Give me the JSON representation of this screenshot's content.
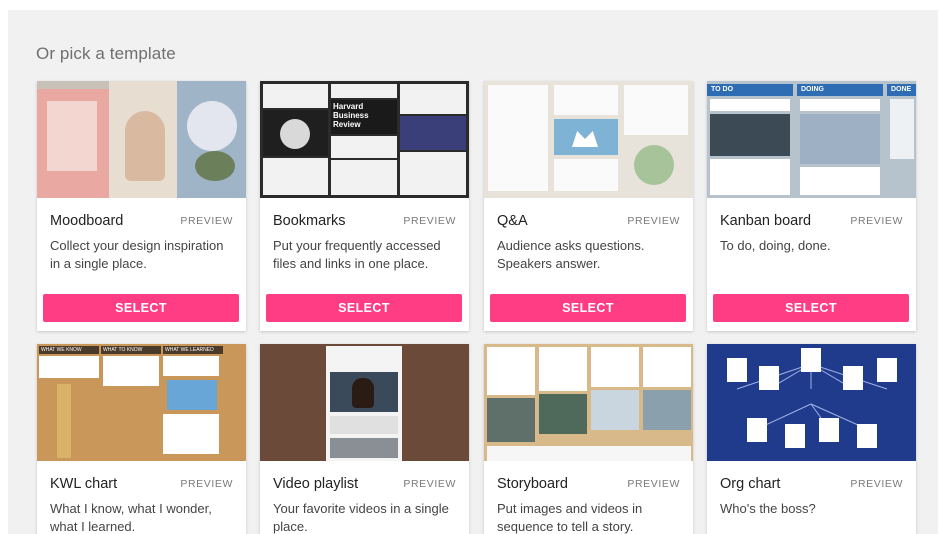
{
  "heading": "Or pick a template",
  "preview_label": "PREVIEW",
  "select_label": "SELECT",
  "cards": [
    {
      "title": "Moodboard",
      "description": "Collect your design inspiration in a single place."
    },
    {
      "title": "Bookmarks",
      "description": "Put your frequently accessed files and links in one place."
    },
    {
      "title": "Q&A",
      "description": "Audience asks questions. Speakers answer."
    },
    {
      "title": "Kanban board",
      "description": "To do, doing, done."
    },
    {
      "title": "KWL chart",
      "description": "What I know, what I wonder, what I learned."
    },
    {
      "title": "Video playlist",
      "description": "Your favorite videos in a single place."
    },
    {
      "title": "Storyboard",
      "description": "Put images and videos in sequence to tell a story."
    },
    {
      "title": "Org chart",
      "description": "Who's the boss?"
    }
  ],
  "thumbnails": {
    "bookmarks_headline": "Harvard Business Review",
    "kanban_columns": [
      "TO DO",
      "DOING",
      "DONE"
    ],
    "kwl_columns": [
      "WHAT WE KNOW",
      "WHAT TO KNOW",
      "WHAT WE LEARNED"
    ]
  },
  "colors": {
    "accent": "#ff3d84",
    "panel_bg": "#f1f1f1"
  }
}
